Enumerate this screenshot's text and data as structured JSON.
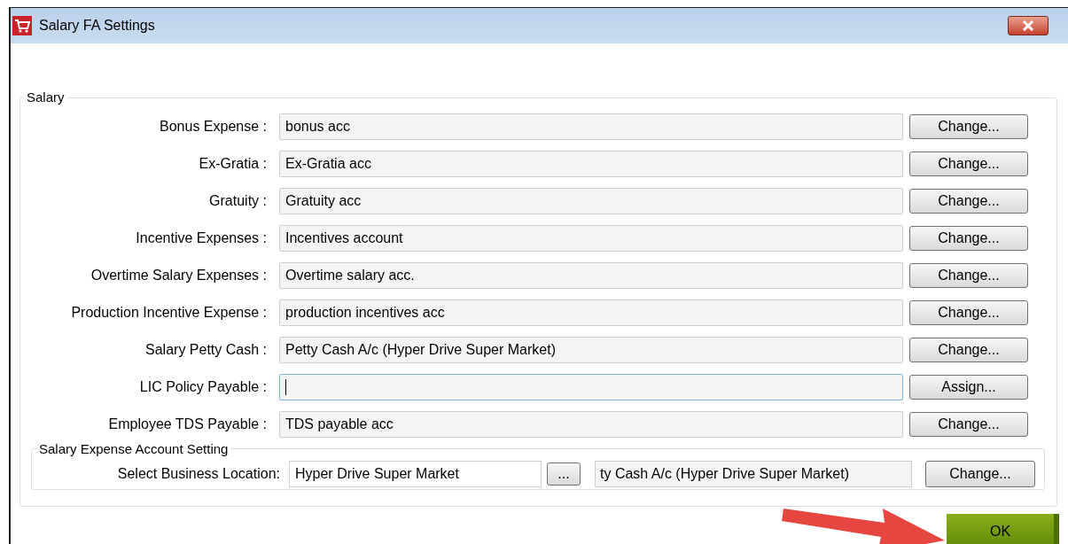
{
  "window": {
    "title": "Salary FA Settings"
  },
  "salary_group": {
    "title": "Salary",
    "rows": [
      {
        "label": "Bonus Expense :",
        "value": "bonus acc",
        "button": "Change...",
        "focused": false
      },
      {
        "label": "Ex-Gratia :",
        "value": "Ex-Gratia acc",
        "button": "Change...",
        "focused": false
      },
      {
        "label": "Gratuity :",
        "value": "Gratuity acc",
        "button": "Change...",
        "focused": false
      },
      {
        "label": "Incentive Expenses :",
        "value": "Incentives account",
        "button": "Change...",
        "focused": false
      },
      {
        "label": "Overtime Salary Expenses :",
        "value": "Overtime salary acc.",
        "button": "Change...",
        "focused": false
      },
      {
        "label": "Production Incentive Expense :",
        "value": "production incentives acc",
        "button": "Change...",
        "focused": false
      },
      {
        "label": "Salary Petty Cash :",
        "value": "Petty Cash A/c (Hyper Drive Super Market)",
        "button": "Change...",
        "focused": false
      },
      {
        "label": "LIC Policy Payable :",
        "value": "",
        "button": "Assign...",
        "focused": true
      },
      {
        "label": "Employee TDS Payable :",
        "value": "TDS payable acc",
        "button": "Change...",
        "focused": false
      }
    ],
    "expense_group": {
      "title": "Salary Expense Account Setting",
      "label": "Select Business Location:",
      "location": "Hyper Drive Super Market",
      "browse_button": "...",
      "account": "ty Cash A/c (Hyper Drive Super Market)",
      "button": "Change..."
    }
  },
  "ok_button": "OK"
}
